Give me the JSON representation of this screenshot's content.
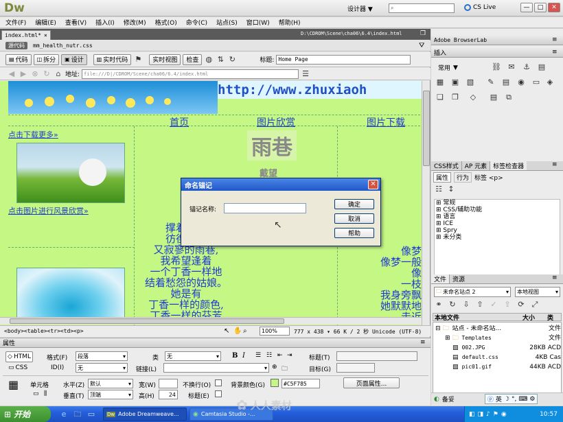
{
  "app": {
    "logo": "Dw",
    "workspace": "设计器 ▼",
    "cslive": "CS Live",
    "window_controls": [
      "—",
      "□",
      "✕"
    ]
  },
  "menu": [
    "文件(F)",
    "编辑(E)",
    "查看(V)",
    "插入(I)",
    "修改(M)",
    "格式(O)",
    "命令(C)",
    "站点(S)",
    "窗口(W)",
    "帮助(H)"
  ],
  "doc": {
    "tab": "index.html*",
    "path": "D:\\CDROM\\Scene\\cha06\\6.4\\index.html",
    "source_label": "源代码",
    "css_file": "mm_health_nutr.css",
    "view_buttons": [
      "代码",
      "拆分",
      "设计",
      "实时代码",
      "实时视图",
      "检查"
    ],
    "title_label": "标题:",
    "title_value": "Home Page",
    "address_label": "地址:",
    "address_value": "file:///D|/CDROM/Scene/cha06/6.4/index.html"
  },
  "page": {
    "url_banner": "http://www.zhuxiaoh",
    "nav": [
      "首页",
      "图片欣赏",
      "图片下载"
    ],
    "link_download": "点击下载更多»",
    "link_scenery": "点击图片进行风景欣赏»",
    "heading": "雨巷",
    "author": "戴望",
    "poem": [
      "撑着油纸",
      "彷徨在悠",
      "又寂寥的雨巷,",
      "我希望逢着",
      "一个丁香一样地",
      "结着愁怨的姑娘。",
      "她是有",
      "丁香一样的颜色,",
      "丁香一样的芬芳"
    ],
    "poem_right": [
      "像梦",
      "像梦一般",
      "像",
      "一枝",
      "我身旁飘",
      "她默默地",
      "走近"
    ]
  },
  "dialog": {
    "title": "命名锚记",
    "label": "锚记名称:",
    "input_value": "",
    "ok": "确定",
    "cancel": "取消",
    "help": "帮助"
  },
  "statusbar": {
    "tags": "<body><table><tr><td><p>",
    "zoom": "100%",
    "info": "777 x 438 ▾ 66 K / 2 秒 Unicode (UTF-8)"
  },
  "properties": {
    "title": "属性",
    "html_tab": "HTML",
    "css_tab": "CSS",
    "format_label": "格式(F)",
    "format_value": "段落",
    "class_label": "类",
    "class_value": "无",
    "id_label": "ID(I)",
    "id_value": "无",
    "link_label": "链接(L)",
    "b": "B",
    "i": "I",
    "title_label": "标题(T)",
    "target_label": "目标(G)",
    "cell_label": "单元格",
    "halign_label": "水平(Z)",
    "halign_value": "默认",
    "valign_label": "垂直(T)",
    "valign_value": "顶端",
    "width_label": "宽(W)",
    "height_label": "高(H)",
    "height_value": "24",
    "nowrap_label": "不换行(O)",
    "header_label": "标题(E)",
    "bgcolor_label": "背景颜色(G)",
    "bgcolor_value": "#C5F785",
    "page_props": "页面属性..."
  },
  "right": {
    "browserlab": "Adobe BrowserLab",
    "insert": "插入",
    "insert_common": "常用",
    "css_tabs": [
      "CSS样式",
      "AP 元素",
      "标签检查器"
    ],
    "attr_tabs": [
      "属性",
      "行为",
      "标签 <p>"
    ],
    "categories": [
      "常规",
      "CSS/辅助功能",
      "语言",
      "ICE",
      "Spry",
      "未分类"
    ],
    "files_tabs": [
      "文件",
      "资源"
    ],
    "site_select": "未命名站点 2",
    "view_select": "本地视图",
    "file_headers": [
      "本地文件",
      "大小",
      "类"
    ],
    "files": [
      {
        "name": "站点 - 未命名站...",
        "size": "",
        "type": "文件"
      },
      {
        "name": "Templates",
        "size": "",
        "type": "文件"
      },
      {
        "name": "002.JPG",
        "size": "28KB",
        "type": "ACD"
      },
      {
        "name": "default.css",
        "size": "4KB",
        "type": "Cas"
      },
      {
        "name": "pic01.gif",
        "size": "44KB",
        "type": "ACD"
      }
    ],
    "ready": "备妥",
    "ime": "英"
  },
  "taskbar": {
    "start": "开始",
    "tasks": [
      "Adobe Dreamweave...",
      "Camtasia Studio -..."
    ],
    "watermark": "人人素材",
    "clock": "10:57"
  },
  "colors": {
    "page_bg": "#c5f785",
    "accent_blue": "#1f3ccc",
    "titlebar": "#ececec",
    "dialog_title": "#3168d5",
    "taskbar": "#245edb",
    "start": "#3c8f2e"
  }
}
